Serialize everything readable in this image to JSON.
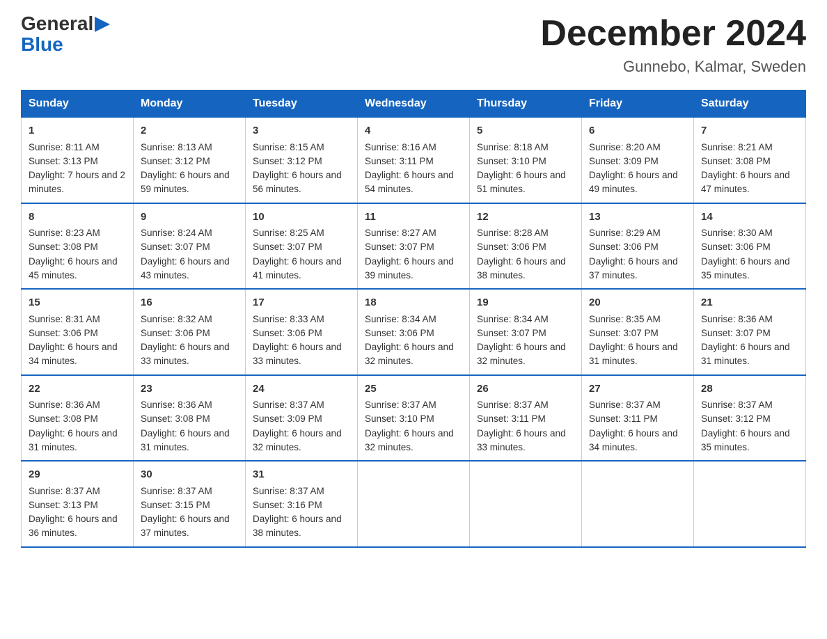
{
  "logo": {
    "general": "General",
    "blue": "Blue"
  },
  "title": "December 2024",
  "subtitle": "Gunnebo, Kalmar, Sweden",
  "days_of_week": [
    "Sunday",
    "Monday",
    "Tuesday",
    "Wednesday",
    "Thursday",
    "Friday",
    "Saturday"
  ],
  "weeks": [
    [
      {
        "day": "1",
        "sunrise": "8:11 AM",
        "sunset": "3:13 PM",
        "daylight": "7 hours and 2 minutes."
      },
      {
        "day": "2",
        "sunrise": "8:13 AM",
        "sunset": "3:12 PM",
        "daylight": "6 hours and 59 minutes."
      },
      {
        "day": "3",
        "sunrise": "8:15 AM",
        "sunset": "3:12 PM",
        "daylight": "6 hours and 56 minutes."
      },
      {
        "day": "4",
        "sunrise": "8:16 AM",
        "sunset": "3:11 PM",
        "daylight": "6 hours and 54 minutes."
      },
      {
        "day": "5",
        "sunrise": "8:18 AM",
        "sunset": "3:10 PM",
        "daylight": "6 hours and 51 minutes."
      },
      {
        "day": "6",
        "sunrise": "8:20 AM",
        "sunset": "3:09 PM",
        "daylight": "6 hours and 49 minutes."
      },
      {
        "day": "7",
        "sunrise": "8:21 AM",
        "sunset": "3:08 PM",
        "daylight": "6 hours and 47 minutes."
      }
    ],
    [
      {
        "day": "8",
        "sunrise": "8:23 AM",
        "sunset": "3:08 PM",
        "daylight": "6 hours and 45 minutes."
      },
      {
        "day": "9",
        "sunrise": "8:24 AM",
        "sunset": "3:07 PM",
        "daylight": "6 hours and 43 minutes."
      },
      {
        "day": "10",
        "sunrise": "8:25 AM",
        "sunset": "3:07 PM",
        "daylight": "6 hours and 41 minutes."
      },
      {
        "day": "11",
        "sunrise": "8:27 AM",
        "sunset": "3:07 PM",
        "daylight": "6 hours and 39 minutes."
      },
      {
        "day": "12",
        "sunrise": "8:28 AM",
        "sunset": "3:06 PM",
        "daylight": "6 hours and 38 minutes."
      },
      {
        "day": "13",
        "sunrise": "8:29 AM",
        "sunset": "3:06 PM",
        "daylight": "6 hours and 37 minutes."
      },
      {
        "day": "14",
        "sunrise": "8:30 AM",
        "sunset": "3:06 PM",
        "daylight": "6 hours and 35 minutes."
      }
    ],
    [
      {
        "day": "15",
        "sunrise": "8:31 AM",
        "sunset": "3:06 PM",
        "daylight": "6 hours and 34 minutes."
      },
      {
        "day": "16",
        "sunrise": "8:32 AM",
        "sunset": "3:06 PM",
        "daylight": "6 hours and 33 minutes."
      },
      {
        "day": "17",
        "sunrise": "8:33 AM",
        "sunset": "3:06 PM",
        "daylight": "6 hours and 33 minutes."
      },
      {
        "day": "18",
        "sunrise": "8:34 AM",
        "sunset": "3:06 PM",
        "daylight": "6 hours and 32 minutes."
      },
      {
        "day": "19",
        "sunrise": "8:34 AM",
        "sunset": "3:07 PM",
        "daylight": "6 hours and 32 minutes."
      },
      {
        "day": "20",
        "sunrise": "8:35 AM",
        "sunset": "3:07 PM",
        "daylight": "6 hours and 31 minutes."
      },
      {
        "day": "21",
        "sunrise": "8:36 AM",
        "sunset": "3:07 PM",
        "daylight": "6 hours and 31 minutes."
      }
    ],
    [
      {
        "day": "22",
        "sunrise": "8:36 AM",
        "sunset": "3:08 PM",
        "daylight": "6 hours and 31 minutes."
      },
      {
        "day": "23",
        "sunrise": "8:36 AM",
        "sunset": "3:08 PM",
        "daylight": "6 hours and 31 minutes."
      },
      {
        "day": "24",
        "sunrise": "8:37 AM",
        "sunset": "3:09 PM",
        "daylight": "6 hours and 32 minutes."
      },
      {
        "day": "25",
        "sunrise": "8:37 AM",
        "sunset": "3:10 PM",
        "daylight": "6 hours and 32 minutes."
      },
      {
        "day": "26",
        "sunrise": "8:37 AM",
        "sunset": "3:11 PM",
        "daylight": "6 hours and 33 minutes."
      },
      {
        "day": "27",
        "sunrise": "8:37 AM",
        "sunset": "3:11 PM",
        "daylight": "6 hours and 34 minutes."
      },
      {
        "day": "28",
        "sunrise": "8:37 AM",
        "sunset": "3:12 PM",
        "daylight": "6 hours and 35 minutes."
      }
    ],
    [
      {
        "day": "29",
        "sunrise": "8:37 AM",
        "sunset": "3:13 PM",
        "daylight": "6 hours and 36 minutes."
      },
      {
        "day": "30",
        "sunrise": "8:37 AM",
        "sunset": "3:15 PM",
        "daylight": "6 hours and 37 minutes."
      },
      {
        "day": "31",
        "sunrise": "8:37 AM",
        "sunset": "3:16 PM",
        "daylight": "6 hours and 38 minutes."
      },
      null,
      null,
      null,
      null
    ]
  ]
}
